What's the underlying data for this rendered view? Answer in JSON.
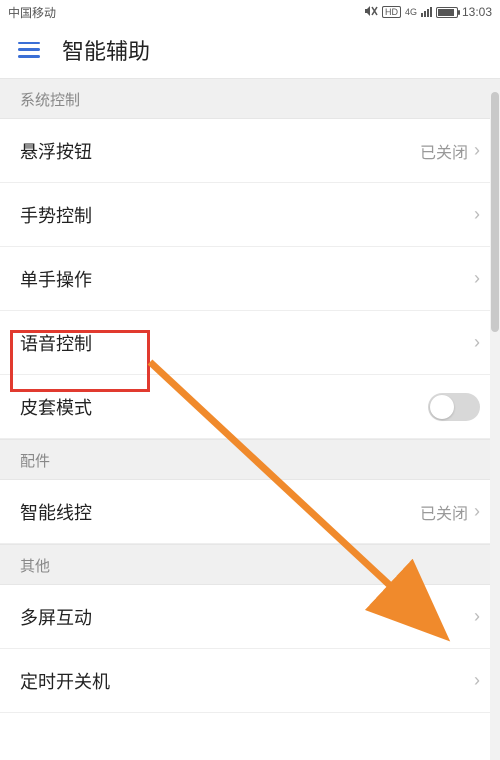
{
  "status_bar": {
    "carrier": "中国移动",
    "time": "13:03",
    "icons": {
      "mute": "mute-icon",
      "hd": "HD",
      "net": "4G",
      "signal": "signal-icon",
      "battery": "battery-icon"
    }
  },
  "header": {
    "menu_icon": "hamburger-icon",
    "title": "智能辅助"
  },
  "sections": [
    {
      "title": "系统控制",
      "items": [
        {
          "label": "悬浮按钮",
          "value": "已关闭",
          "kind": "nav"
        },
        {
          "label": "手势控制",
          "value": "",
          "kind": "nav"
        },
        {
          "label": "单手操作",
          "value": "",
          "kind": "nav"
        },
        {
          "label": "语音控制",
          "value": "",
          "kind": "nav",
          "highlighted": true
        },
        {
          "label": "皮套模式",
          "value": "",
          "kind": "toggle",
          "toggle_on": false
        }
      ]
    },
    {
      "title": "配件",
      "items": [
        {
          "label": "智能线控",
          "value": "已关闭",
          "kind": "nav"
        }
      ]
    },
    {
      "title": "其他",
      "items": [
        {
          "label": "多屏互动",
          "value": "",
          "kind": "nav"
        },
        {
          "label": "定时开关机",
          "value": "",
          "kind": "nav"
        }
      ]
    }
  ],
  "annotation": {
    "highlight_color": "#e13a2f",
    "arrow_color": "#f08a2c"
  }
}
